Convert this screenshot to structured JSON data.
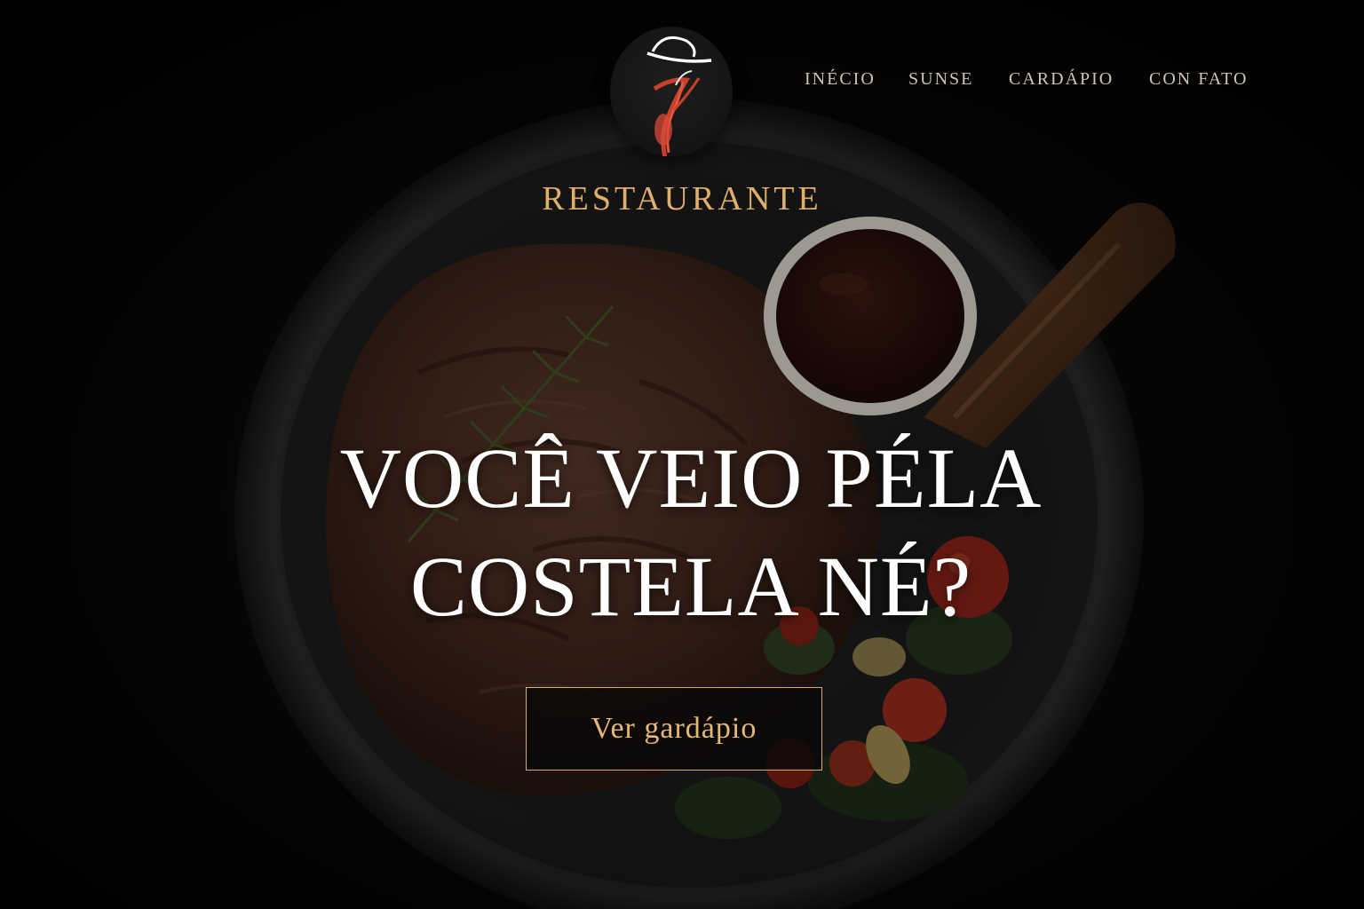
{
  "brand": {
    "name": "RESTAURANTE",
    "logo_icon": "chef-hat-figure-icon",
    "accent_color": "#e0b06a"
  },
  "nav": {
    "items": [
      {
        "label": "INÉCIO"
      },
      {
        "label": "SUNSE"
      },
      {
        "label": "CARDÁPIO"
      },
      {
        "label": "CON FATO"
      }
    ]
  },
  "hero": {
    "headline_line1": "VOCÊ VEIO PÉLA",
    "headline_line2": "COSTELA NÉ?",
    "cta_label": "Ver gardápio"
  }
}
